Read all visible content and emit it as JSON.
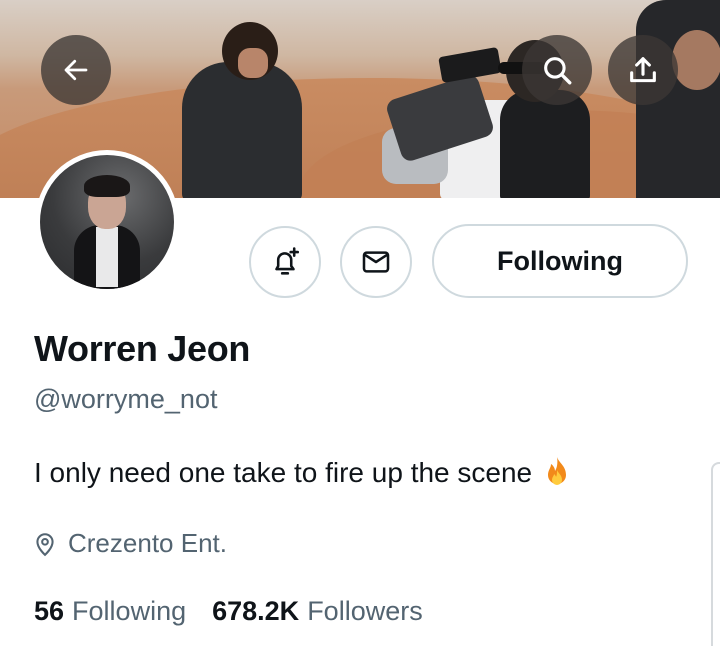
{
  "header": {
    "back_icon": "arrow-left-icon",
    "search_icon": "search-icon",
    "share_icon": "share-upload-icon"
  },
  "profile": {
    "name": "Worren Jeon",
    "handle": "@worryme_not",
    "bio": "I only need one take to fire up the scene",
    "bio_emoji": "fire-emoji",
    "location": "Crezento Ent.",
    "location_icon": "location-pin-icon"
  },
  "actions": {
    "notify_icon": "bell-plus-icon",
    "message_icon": "envelope-icon",
    "follow_label": "Following"
  },
  "stats": {
    "following_count": "56",
    "following_label": "Following",
    "followers_count": "678.2K",
    "followers_label": "Followers"
  },
  "colors": {
    "text_primary": "#0f1419",
    "text_secondary": "#536471",
    "border": "#cfd9de",
    "overlay_button": "#3c3734"
  }
}
